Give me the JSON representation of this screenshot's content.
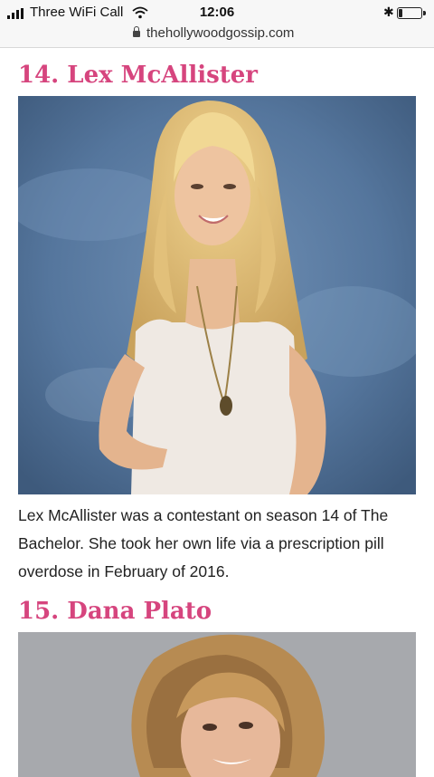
{
  "status_bar": {
    "carrier": "Three WiFi Call",
    "time": "12:06",
    "signal_bars": 4,
    "battery_level": 0.15,
    "icons": [
      "signal-icon",
      "wifi-icon",
      "bluetooth-icon",
      "battery-icon"
    ]
  },
  "url_bar": {
    "url": "thehollywoodgossip.com",
    "icon": "lock-icon"
  },
  "article": {
    "accent_color": "#d6457e",
    "entries": [
      {
        "heading": "14. Lex McAllister",
        "caption": "Lex McAllister was a contestant on season 14 of The Bachelor. She took her own life via a prescription pill overdose in February of 2016."
      },
      {
        "heading": "15. Dana Plato"
      }
    ]
  }
}
